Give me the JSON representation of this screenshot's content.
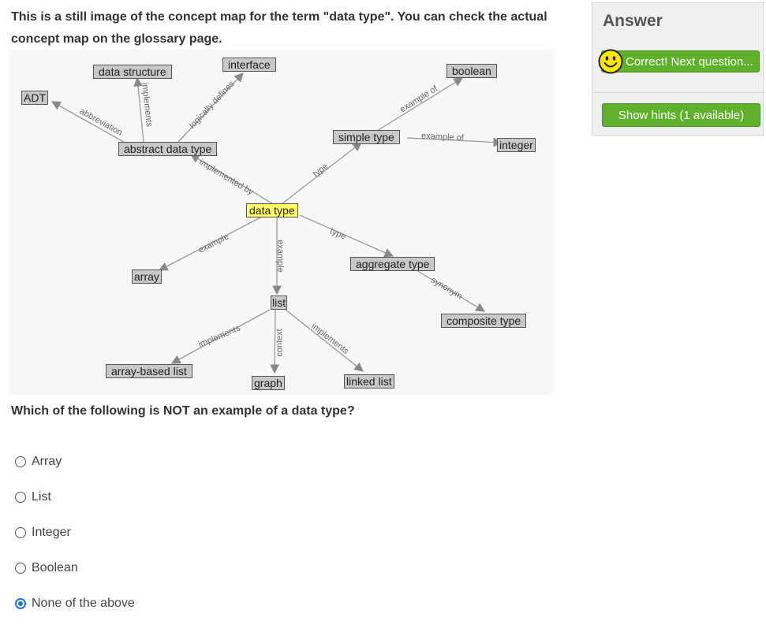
{
  "question": {
    "intro": "This is a still image of the concept map for the term \"data type\". You can check the actual concept map on the glossary page.",
    "text": "Which of the following is NOT an example of a data type?",
    "options": [
      {
        "label": "Array",
        "selected": false
      },
      {
        "label": "List",
        "selected": false
      },
      {
        "label": "Integer",
        "selected": false
      },
      {
        "label": "Boolean",
        "selected": false
      },
      {
        "label": "None of the above",
        "selected": true
      }
    ]
  },
  "concept_map": {
    "nodes": {
      "data_type": "data type",
      "interface": "interface",
      "data_structure": "data structure",
      "adt": "ADT",
      "abstract_data_type": "abstract data type",
      "boolean": "boolean",
      "simple_type": "simple type",
      "integer": "integer",
      "array": "array",
      "aggregate_type": "aggregate type",
      "composite_type": "composite type",
      "list": "list",
      "array_based_list": "array-based list",
      "graph": "graph",
      "linked_list": "linked list"
    },
    "edges": {
      "implements_ds": "implements",
      "logically_defines": "logically defines",
      "abbreviation": "abbreviation",
      "implemented_by": "implemented by",
      "type_simple": "type",
      "example_of_boolean": "example of",
      "example_of_integer": "example of",
      "type_aggregate": "type",
      "example_array": "example",
      "example_list": "example",
      "synonym": "synonym",
      "implements_abl": "implements",
      "context": "context",
      "implements_ll": "implements"
    },
    "colors": {
      "node_fill": "#c8c8c8",
      "center_fill": "#ffff66",
      "edge_color": "#888888"
    }
  },
  "answer_panel": {
    "title": "Answer",
    "next_label": "Correct! Next question...",
    "hints_label": "Show hints (1 available)",
    "status_icon": "smiley-face-icon",
    "accent_color": "#5fb02a"
  }
}
